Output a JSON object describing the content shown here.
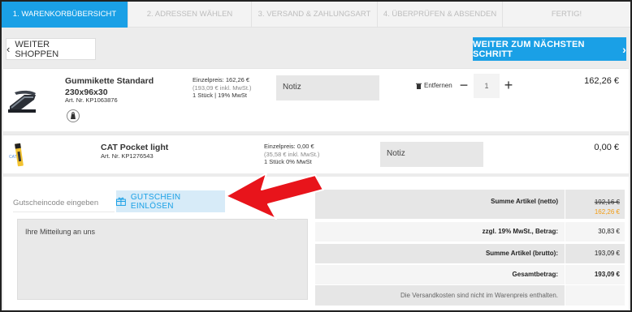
{
  "steps": [
    {
      "label": "1. WARENKORBÜBERSICHT",
      "active": true
    },
    {
      "label": "2. ADRESSEN WÄHLEN",
      "active": false
    },
    {
      "label": "3. VERSAND & ZAHLUNGSART",
      "active": false
    },
    {
      "label": "4. ÜBERPRÜFEN & ABSENDEN",
      "active": false
    },
    {
      "label": "FERTIG!",
      "active": false
    }
  ],
  "actions": {
    "back_label": "WEITER SHOPPEN",
    "next_label": "WEITER ZUM NÄCHSTEN SCHRITT"
  },
  "items": [
    {
      "name_line1": "Gummikette Standard",
      "name_line2": "230x96x30",
      "art_nr": "Art. Nr. KP1063876",
      "unit_price": "Einzelpreis: 162,26 €",
      "unit_price_gross": "(193,09 € inkl. MwSt.)",
      "qty_tax": "1 Stück | 19% MwSt",
      "note_placeholder": "Notiz",
      "remove_label": "Entfernen",
      "quantity": "1",
      "total": "162,26 €"
    },
    {
      "name_line1": "CAT Pocket light",
      "art_nr": "Art. Nr. KP1276543",
      "unit_price": "Einzelpreis: 0,00 €",
      "unit_price_gross": "(35,58 € inkl. MwSt.)",
      "qty_tax": "1 Stück 0% MwSt",
      "note_placeholder": "Notiz",
      "total": "0,00 €"
    }
  ],
  "coupon": {
    "placeholder": "Gutscheincode eingeben",
    "button_label": "GUTSCHEIN EINLÖSEN"
  },
  "message": {
    "placeholder": "Ihre Mitteilung an uns"
  },
  "summary": {
    "net_label": "Summe Artikel (netto)",
    "net_old": "192,16 €",
    "net_new": "162,26 €",
    "vat_label": "zzgl. 19% MwSt., Betrag:",
    "vat_value": "30,83 €",
    "gross_label": "Summe Artikel (brutto):",
    "gross_value": "193,09 €",
    "total_label": "Gesamtbetrag:",
    "total_value": "193,09 €",
    "shipping_note": "Die Versandkosten sind nicht im Warenpreis enthalten."
  },
  "colors": {
    "accent": "#1aa0e6",
    "discount": "#f39c12",
    "arrow": "#e8141b"
  }
}
